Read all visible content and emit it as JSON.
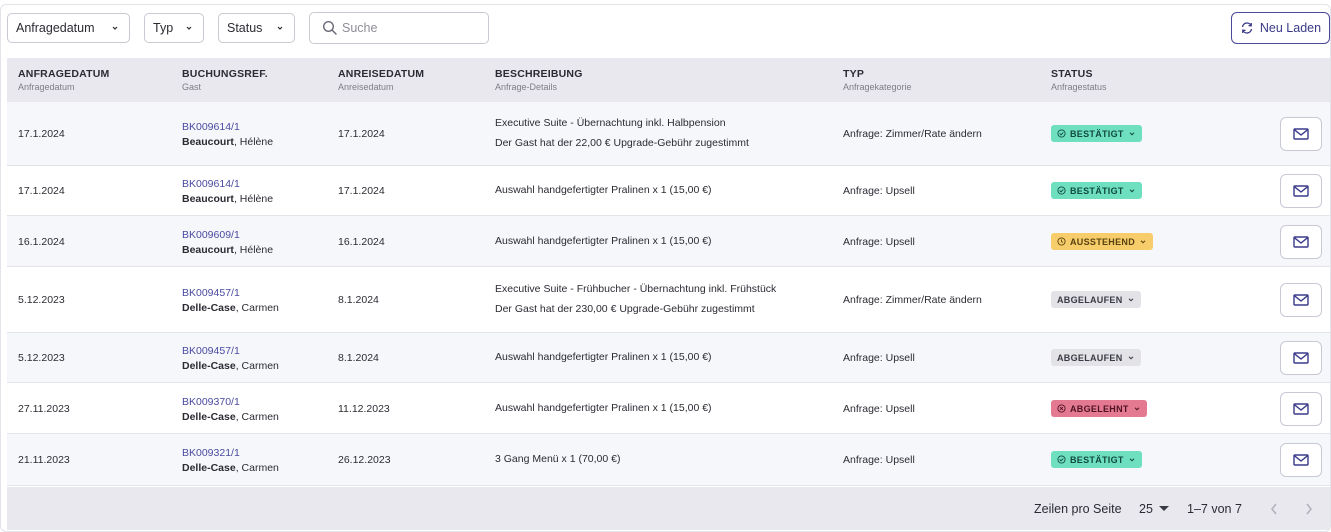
{
  "filters": {
    "date_label": "Anfragedatum",
    "type_label": "Typ",
    "status_label": "Status",
    "search_placeholder": "Suche",
    "reload_label": "Neu Laden"
  },
  "columns": [
    {
      "title": "ANFRAGEDATUM",
      "sub": "Anfragedatum"
    },
    {
      "title": "BUCHUNGSREF.",
      "sub": "Gast"
    },
    {
      "title": "ANREISEDATUM",
      "sub": "Anreisedatum"
    },
    {
      "title": "BESCHREIBUNG",
      "sub": "Anfrage-Details"
    },
    {
      "title": "TYP",
      "sub": "Anfragekategorie"
    },
    {
      "title": "STATUS",
      "sub": "Anfragestatus"
    }
  ],
  "rows": [
    {
      "date": "17.1.2024",
      "ref": "BK009614/1",
      "guest_last": "Beaucourt",
      "guest_first": ", Hélène",
      "arrival": "17.1.2024",
      "desc1": "Executive Suite - Übernachtung inkl. Halbpension",
      "desc2": "Der Gast hat der 22,00 € Upgrade-Gebühr zugestimmt",
      "type": "Anfrage: Zimmer/Rate ändern",
      "status": "BESTÄTIGT"
    },
    {
      "date": "17.1.2024",
      "ref": "BK009614/1",
      "guest_last": "Beaucourt",
      "guest_first": ", Hélène",
      "arrival": "17.1.2024",
      "desc1": "Auswahl handgefertigter Pralinen x 1 (15,00 €)",
      "desc2": "",
      "type": "Anfrage: Upsell",
      "status": "BESTÄTIGT"
    },
    {
      "date": "16.1.2024",
      "ref": "BK009609/1",
      "guest_last": "Beaucourt",
      "guest_first": ", Hélène",
      "arrival": "16.1.2024",
      "desc1": "Auswahl handgefertigter Pralinen x 1 (15,00 €)",
      "desc2": "",
      "type": "Anfrage: Upsell",
      "status": "AUSSTEHEND"
    },
    {
      "date": "5.12.2023",
      "ref": "BK009457/1",
      "guest_last": "Delle-Case",
      "guest_first": ", Carmen",
      "arrival": "8.1.2024",
      "desc1": "Executive Suite - Frühbucher - Übernachtung inkl. Frühstück",
      "desc2": "Der Gast hat der 230,00 € Upgrade-Gebühr zugestimmt",
      "type": "Anfrage: Zimmer/Rate ändern",
      "status": "ABGELAUFEN"
    },
    {
      "date": "5.12.2023",
      "ref": "BK009457/1",
      "guest_last": "Delle-Case",
      "guest_first": ", Carmen",
      "arrival": "8.1.2024",
      "desc1": "Auswahl handgefertigter Pralinen x 1 (15,00 €)",
      "desc2": "",
      "type": "Anfrage: Upsell",
      "status": "ABGELAUFEN"
    },
    {
      "date": "27.11.2023",
      "ref": "BK009370/1",
      "guest_last": "Delle-Case",
      "guest_first": ", Carmen",
      "arrival": "11.12.2023",
      "desc1": "Auswahl handgefertigter Pralinen x 1 (15,00 €)",
      "desc2": "",
      "type": "Anfrage: Upsell",
      "status": "ABGELEHNT"
    },
    {
      "date": "21.11.2023",
      "ref": "BK009321/1",
      "guest_last": "Delle-Case",
      "guest_first": ", Carmen",
      "arrival": "26.12.2023",
      "desc1": "3 Gang Menü x 1 (70,00 €)",
      "desc2": "",
      "type": "Anfrage: Upsell",
      "status": "BESTÄTIGT"
    }
  ],
  "status_colors": {
    "BESTÄTIGT": "#6ee0c0",
    "AUSSTEHEND": "#f6cd6a",
    "ABGELAUFEN": "#e2e2e7",
    "ABGELEHNT": "#e47a92"
  },
  "footer": {
    "rows_per_page_label": "Zeilen pro Seite",
    "rows_per_page_value": "25",
    "range_text": "1–7 von 7"
  }
}
